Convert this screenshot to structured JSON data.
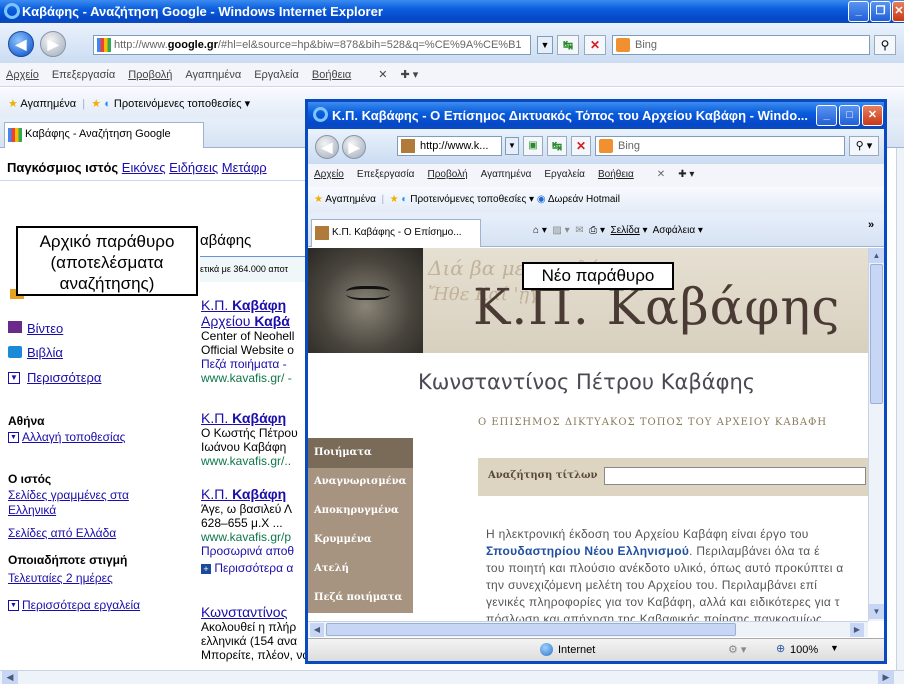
{
  "main": {
    "title": "Καβάφης - Αναζήτηση Google - Windows Internet Explorer",
    "url_pre": "http://www.",
    "url_bold": "google.gr",
    "url_post": "/#hl=el&source=hp&biw=878&bih=528&q=%CE%9A%CE%B1",
    "search_placeholder": "Bing",
    "menu": [
      "Αρχείο",
      "Επεξεργασία",
      "Προβολή",
      "Αγαπημένα",
      "Εργαλεία",
      "Βοήθεια"
    ],
    "fav_label": "Αγαπημένα",
    "suggested": "Προτεινόμενες τοποθεσίες",
    "tab": "Καβάφης - Αναζήτηση Google",
    "g_nav": {
      "web": "Παγκόσμιος ιστός",
      "images": "Εικόνες",
      "news": "Ειδήσεις",
      "translate": "Μετάφρ"
    },
    "query": "αβάφης",
    "stats": "ετικά με 364.000 αποτ",
    "side": {
      "video": "Βίντεο",
      "books": "Βιβλία",
      "more": "Περισσότερα",
      "loc_head": "Αθήνα",
      "loc_change": "Αλλαγή τοποθεσίας",
      "web_head": "Ο ιστός",
      "greek_pages": "Σελίδες γραμμένες στα Ελληνικά",
      "greece_pages": "Σελίδες από Ελλάδα",
      "time_head": "Οποιαδήποτε στιγμή",
      "last2": "Τελευταίες 2 ημέρες",
      "more_tools": "Περισσότερα εργαλεία"
    },
    "results": [
      {
        "t1": "Κ.Π. ",
        "t1b": "Καβάφη",
        "t2": "Αρχείου ",
        "t2b": "Καβά",
        "d1": "Center of Neohell",
        "d2": "Official Website o",
        "d3": "Πεζά ποιήματα - ",
        "u": "www.kavafis.gr/ -"
      },
      {
        "t1": "Κ.Π. ",
        "t1b": "Καβάφη",
        "d1": "Ο Κωστής Πέτρου",
        "d2": "Ιωάνου Καβάφη",
        "u": "www.kavafis.gr/.."
      },
      {
        "t1": "Κ.Π. ",
        "t1b": "Καβάφη",
        "d1": "Άγε, ω βασιλεύ Λ",
        "d2": "628–655 μ.Χ ...",
        "u": "www.kavafis.gr/p",
        "c": "Προσωρινά αποθ",
        "more": "Περισσότερα α"
      },
      {
        "t1": "Κωνσταντίνος ",
        "d1": "Ακολουθεί η πλήρ",
        "d2": "ελληνικά (154 ανα",
        "d3": "Μπορείτε, πλέον, να διαβάσετε ότι τα ..."
      }
    ]
  },
  "popup": {
    "title": "Κ.Π. Καβάφης - Ο Επίσημος Δικτυακός Τόπος του Αρχείου Καβάφη - Windo...",
    "url": "http://www.k...",
    "search_placeholder": "Bing",
    "menu": [
      "Αρχείο",
      "Επεξεργασία",
      "Προβολή",
      "Αγαπημένα",
      "Εργαλεία",
      "Βοήθεια"
    ],
    "fav": "Αγαπημένα",
    "suggested": "Προτεινόμενες τοποθεσίες",
    "hotmail": "Δωρεάν Hotmail",
    "tab": "Κ.Π. Καβάφης - Ο Επίσημο...",
    "page": "Σελίδα",
    "safety": "Ασφάλεια",
    "banner_title": "Κ.Π. Καβάφης",
    "subtitle": "Κωνσταντίνος Πέτρου Καβάφης",
    "official": "Ο ΕΠΙΣΗΜΟΣ ΔΙΚΤΥΑΚΟΣ ΤΟΠΟΣ ΤΟΥ ΑΡΧΕΙΟΥ ΚΑΒΑΦΗ",
    "sidebar": [
      "Ποιήματα",
      "Αναγνωρισμένα",
      "Αποκηρυγμένα",
      "Κρυμμένα",
      "Ατελή",
      "Πεζά ποιήματα"
    ],
    "search_label": "Αναζήτηση τίτλων",
    "body": "Η ηλεκτρονική έκδοση του Αρχείου Καβάφη είναι έργο του",
    "body_bold": "Σπουδαστηρίου Νέου Ελληνισμού",
    "body2": ". Περιλαμβάνει όλα τα έ",
    "body3": "του ποιητή και πλούσιο ανέκδοτο υλικό, όπως αυτό προκύπτει α",
    "body4": "την συνεχιζόμενη μελέτη του Αρχείου του. Περιλαμβάνει επί",
    "body5": "γενικές πληροφορίες για τον Καβάφη, αλλά και ειδικότερες για τ",
    "body6": "πόσλωση και απήχηση της Καβαφικής ποίησης πανκοσμίως.",
    "status_zone": "Internet",
    "zoom": "100%"
  },
  "labels": {
    "orig_l1": "Αρχικό παράθυρο",
    "orig_l2": "(αποτελέσματα",
    "orig_l3": "αναζήτησης)",
    "new": "Νέο παράθυρο"
  }
}
